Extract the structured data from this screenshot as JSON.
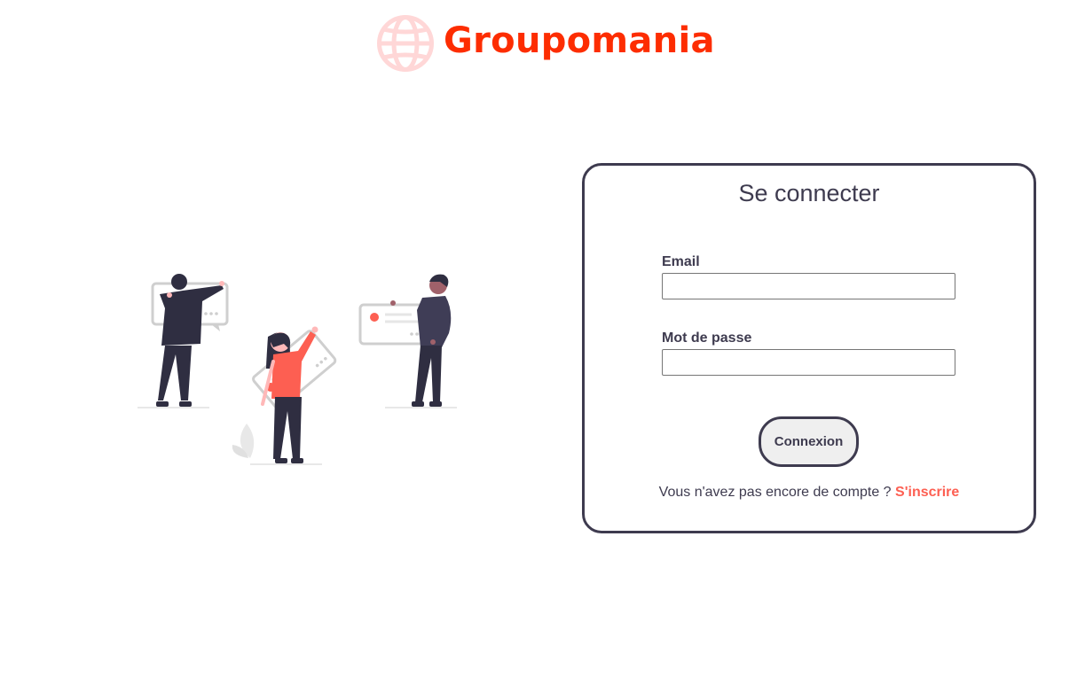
{
  "brand": {
    "name": "Groupomania",
    "color": "#fd2d01",
    "globe_color": "#ffd7d7"
  },
  "login": {
    "title": "Se connecter",
    "email_label": "Email",
    "email_value": "",
    "password_label": "Mot de passe",
    "password_value": "",
    "submit_label": "Connexion",
    "signup_prompt": "Vous n'avez pas encore de compte ?",
    "signup_link": "S'inscrire"
  },
  "colors": {
    "dark": "#3e3b4f",
    "accent": "#fd5f52",
    "button_bg": "#efefef"
  }
}
